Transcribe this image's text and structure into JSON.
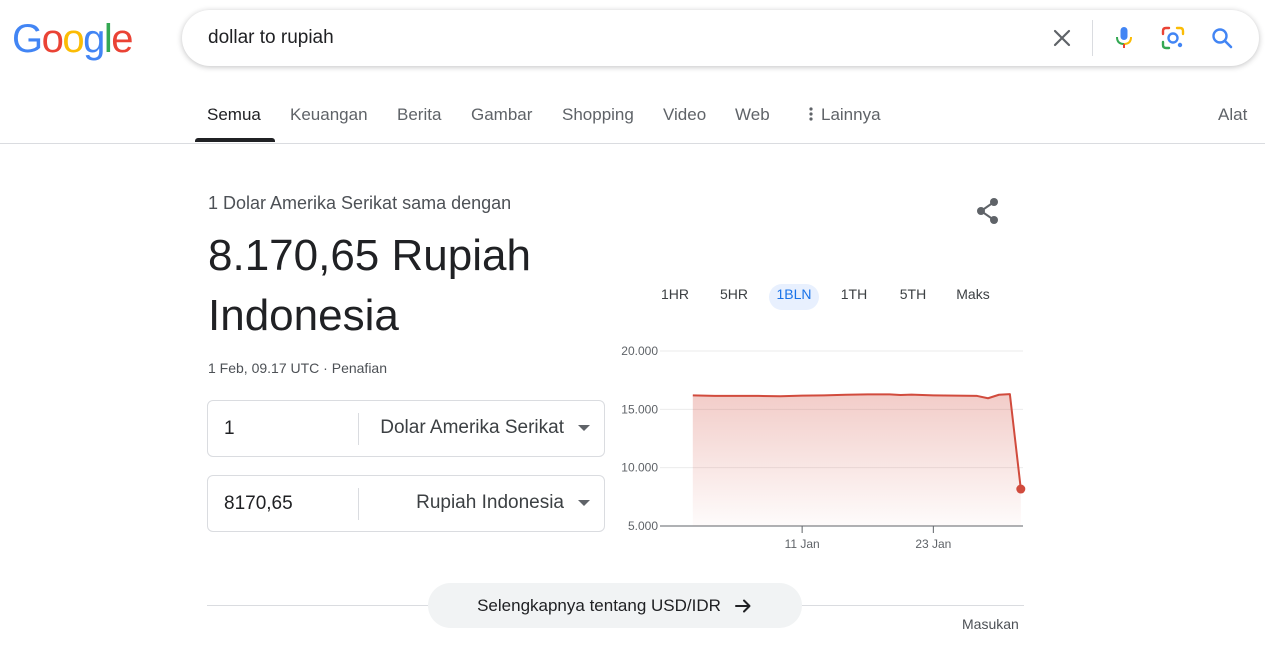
{
  "logo": {
    "letters": [
      "G",
      "o",
      "o",
      "g",
      "l",
      "e"
    ],
    "colors": [
      "#4285F4",
      "#EA4335",
      "#FBBC05",
      "#4285F4",
      "#34A853",
      "#EA4335"
    ]
  },
  "search": {
    "query": "dollar to rupiah",
    "icons": [
      "close-icon",
      "microphone-icon",
      "lens-icon",
      "search-icon"
    ]
  },
  "tabs": [
    {
      "label": "Semua",
      "active": true
    },
    {
      "label": "Keuangan"
    },
    {
      "label": "Berita"
    },
    {
      "label": "Gambar"
    },
    {
      "label": "Shopping"
    },
    {
      "label": "Video"
    },
    {
      "label": "Web"
    },
    {
      "label": "Lainnya"
    }
  ],
  "tools_label": "Alat",
  "converter": {
    "subtitle": "1 Dolar Amerika Serikat sama dengan",
    "result_line1": "8.170,65 Rupiah",
    "result_line2": "Indonesia",
    "timestamp": "1 Feb, 09.17 UTC",
    "separator": " · ",
    "disclaimer": "Penafian",
    "from_amount": "1",
    "from_currency": "Dolar Amerika Serikat",
    "to_amount": "8170,65",
    "to_currency": "Rupiah Indonesia"
  },
  "ranges": [
    {
      "label": "1HR"
    },
    {
      "label": "5HR"
    },
    {
      "label": "1BLN",
      "active": true
    },
    {
      "label": "1TH"
    },
    {
      "label": "5TH"
    },
    {
      "label": "Maks"
    }
  ],
  "chart_data": {
    "type": "area",
    "ylim": [
      5000,
      20000
    ],
    "yticks": [
      20000,
      15000,
      10000,
      5000
    ],
    "ytick_labels": [
      "20.000",
      "15.000",
      "10.000",
      "5.000"
    ],
    "xtick_labels": [
      "11 Jan",
      "23 Jan"
    ],
    "xtick_days": [
      11,
      23
    ],
    "xlim_days": [
      -2,
      31.2
    ],
    "x_days": [
      1,
      3,
      5,
      7,
      9,
      11,
      13,
      15,
      17,
      19,
      20,
      21,
      23,
      25,
      27,
      28,
      29,
      30,
      31
    ],
    "values": [
      16200,
      16150,
      16150,
      16150,
      16120,
      16180,
      16200,
      16250,
      16280,
      16280,
      16230,
      16260,
      16200,
      16180,
      16150,
      15950,
      16250,
      16300,
      8170.65
    ],
    "line_color": "#d14b3d",
    "grid": true
  },
  "more": {
    "label": "Selengkapnya tentang USD/IDR"
  },
  "feedback": "Masukan"
}
